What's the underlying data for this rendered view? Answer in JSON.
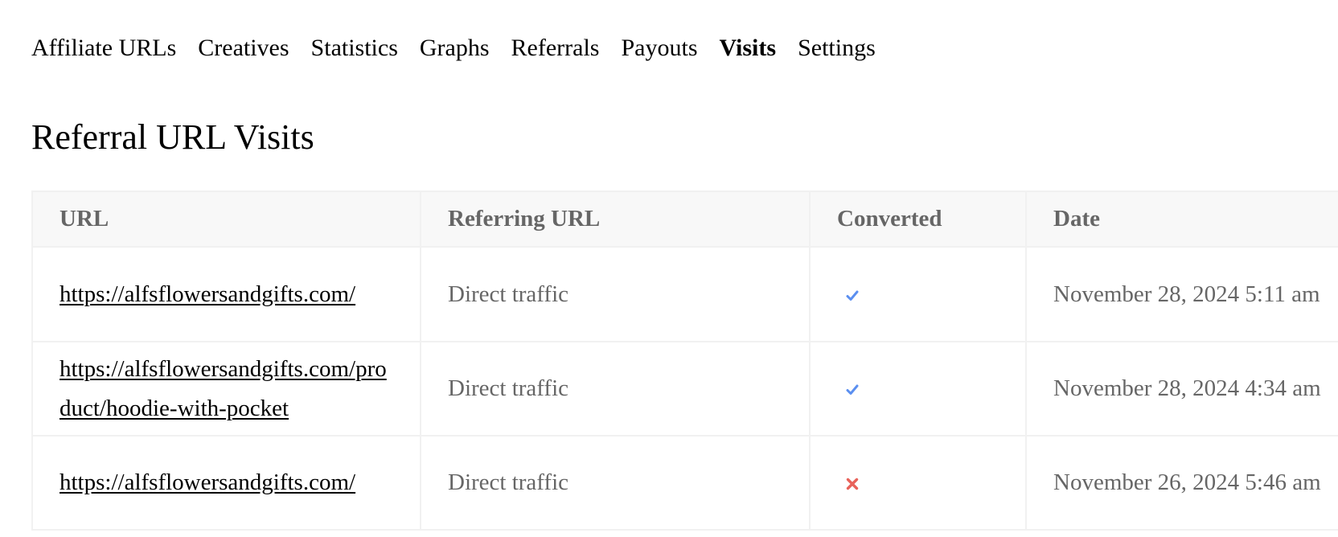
{
  "nav": {
    "items": [
      {
        "label": "Affiliate URLs",
        "active": false
      },
      {
        "label": "Creatives",
        "active": false
      },
      {
        "label": "Statistics",
        "active": false
      },
      {
        "label": "Graphs",
        "active": false
      },
      {
        "label": "Referrals",
        "active": false
      },
      {
        "label": "Payouts",
        "active": false
      },
      {
        "label": "Visits",
        "active": true
      },
      {
        "label": "Settings",
        "active": false
      }
    ]
  },
  "page": {
    "title": "Referral URL Visits"
  },
  "table": {
    "headers": [
      "URL",
      "Referring URL",
      "Converted",
      "Date"
    ],
    "rows": [
      {
        "url": "https://alfsflowersandgifts.com/",
        "referring": "Direct traffic",
        "converted": true,
        "converted_icon": "check-icon",
        "date": "November 28, 2024 5:11 am"
      },
      {
        "url": "https://alfsflowersandgifts.com/product/hoodie-with-pocket",
        "referring": "Direct traffic",
        "converted": true,
        "converted_icon": "check-icon",
        "date": "November 28, 2024 4:34 am"
      },
      {
        "url": "https://alfsflowersandgifts.com/",
        "referring": "Direct traffic",
        "converted": false,
        "converted_icon": "cross-icon",
        "date": "November 26, 2024 5:46 am"
      }
    ]
  },
  "colors": {
    "check": "#5b8ff0",
    "cross": "#e8625a"
  }
}
